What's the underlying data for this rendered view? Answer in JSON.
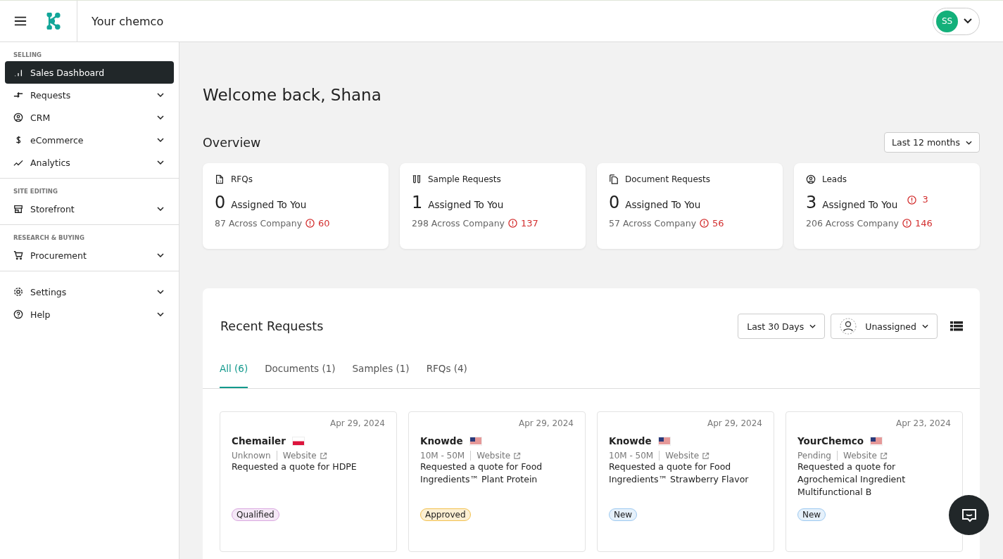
{
  "header": {
    "company": "Your chemco",
    "avatar_initials": "SS"
  },
  "sidebar": {
    "sections": [
      {
        "heading": "SELLING",
        "items": [
          {
            "label": "Sales Dashboard",
            "selected": true,
            "has_submenu": false
          },
          {
            "label": "Requests",
            "selected": false,
            "has_submenu": true
          },
          {
            "label": "CRM",
            "selected": false,
            "has_submenu": true
          },
          {
            "label": "eCommerce",
            "selected": false,
            "has_submenu": true
          },
          {
            "label": "Analytics",
            "selected": false,
            "has_submenu": true
          }
        ]
      },
      {
        "heading": "SITE EDITING",
        "items": [
          {
            "label": "Storefront",
            "selected": false,
            "has_submenu": true
          }
        ]
      },
      {
        "heading": "RESEARCH & BUYING",
        "items": [
          {
            "label": "Procurement",
            "selected": false,
            "has_submenu": true
          }
        ]
      },
      {
        "items": [
          {
            "label": "Settings",
            "selected": false,
            "has_submenu": true
          },
          {
            "label": "Help",
            "selected": false,
            "has_submenu": true
          }
        ]
      }
    ]
  },
  "welcome": "Welcome back, Shana",
  "overview": {
    "title": "Overview",
    "period": "Last 12 months"
  },
  "stats": [
    {
      "title": "RFQs",
      "count": "0",
      "assigned": "Assigned To You",
      "company": "87 Across Company",
      "alert": "60"
    },
    {
      "title": "Sample Requests",
      "count": "1",
      "assigned": "Assigned To You",
      "company": "298 Across Company",
      "alert": "137"
    },
    {
      "title": "Document Requests",
      "count": "0",
      "assigned": "Assigned To You",
      "company": "57 Across Company",
      "alert": "56"
    },
    {
      "title": "Leads",
      "count": "3",
      "assigned": "Assigned To You",
      "assigned_alert": "3",
      "company": "206 Across Company",
      "alert": "146"
    }
  ],
  "recent": {
    "title": "Recent Requests",
    "period": "Last 30 Days",
    "assignee": "Unassigned",
    "tabs": [
      {
        "label": "All (6)",
        "selected": true
      },
      {
        "label": "Documents (1)",
        "selected": false
      },
      {
        "label": "Samples (1)",
        "selected": false
      },
      {
        "label": "RFQs (4)",
        "selected": false
      }
    ],
    "requests": [
      {
        "date": "Apr 29, 2024",
        "company": "Chemailer",
        "flag": {
          "kind": "pl"
        },
        "size": "Unknown",
        "link": "Website",
        "text": "Requested a quote for HDPE",
        "status": "Qualified",
        "color": "#d9a6df"
      },
      {
        "date": "Apr 29, 2024",
        "company": "Knowde",
        "flag": {
          "kind": "us"
        },
        "size": "10M - 50M",
        "link": "Website",
        "text": "Requested a quote for Food Ingredients™ Plant Protein",
        "status": "Approved",
        "color": "#f2c14e"
      },
      {
        "date": "Apr 29, 2024",
        "company": "Knowde",
        "flag": {
          "kind": "us"
        },
        "size": "10M - 50M",
        "link": "Website",
        "text": "Requested a quote for Food Ingredients™ Strawberry Flavor",
        "status": "New",
        "color": "#9cc9f0"
      },
      {
        "date": "Apr 23, 2024",
        "company": "YourChemco",
        "flag": {
          "kind": "us"
        },
        "size": "Pending",
        "link": "Website",
        "text": "Requested a quote for Agrochemical Ingredient Multifunctional B",
        "status": "New",
        "color": "#9cc9f0"
      }
    ]
  }
}
